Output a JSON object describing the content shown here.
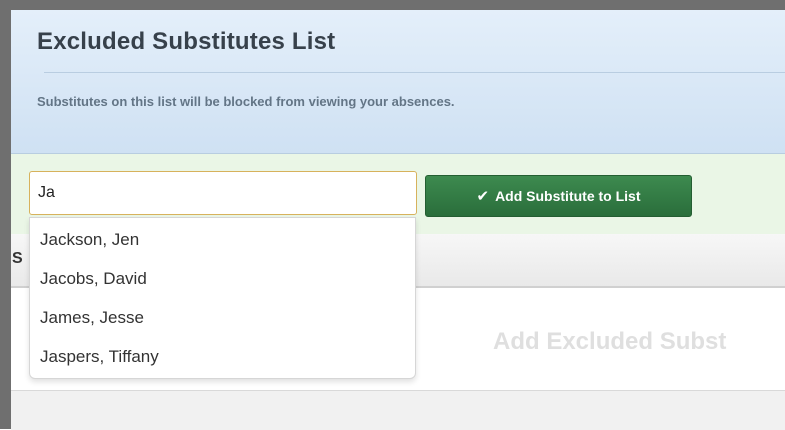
{
  "header": {
    "title": "Excluded Substitutes List",
    "subtitle": "Substitutes on this list will be blocked from viewing your absences."
  },
  "search": {
    "value": "Ja"
  },
  "add_button": {
    "icon": "check-icon",
    "label": "Add Substitute to List"
  },
  "tabstrip": {
    "partial_label": "S"
  },
  "suggestions": [
    "Jackson, Jen",
    "Jacobs, David",
    "James, Jesse",
    "Jaspers, Tiffany"
  ],
  "empty_state": {
    "text": "Add Excluded Subst"
  },
  "colors": {
    "header_bg": "#d9e8f6",
    "toolbar_bg": "#eaf6e6",
    "button_green": "#2f7a43",
    "input_border": "#d7b25c"
  }
}
